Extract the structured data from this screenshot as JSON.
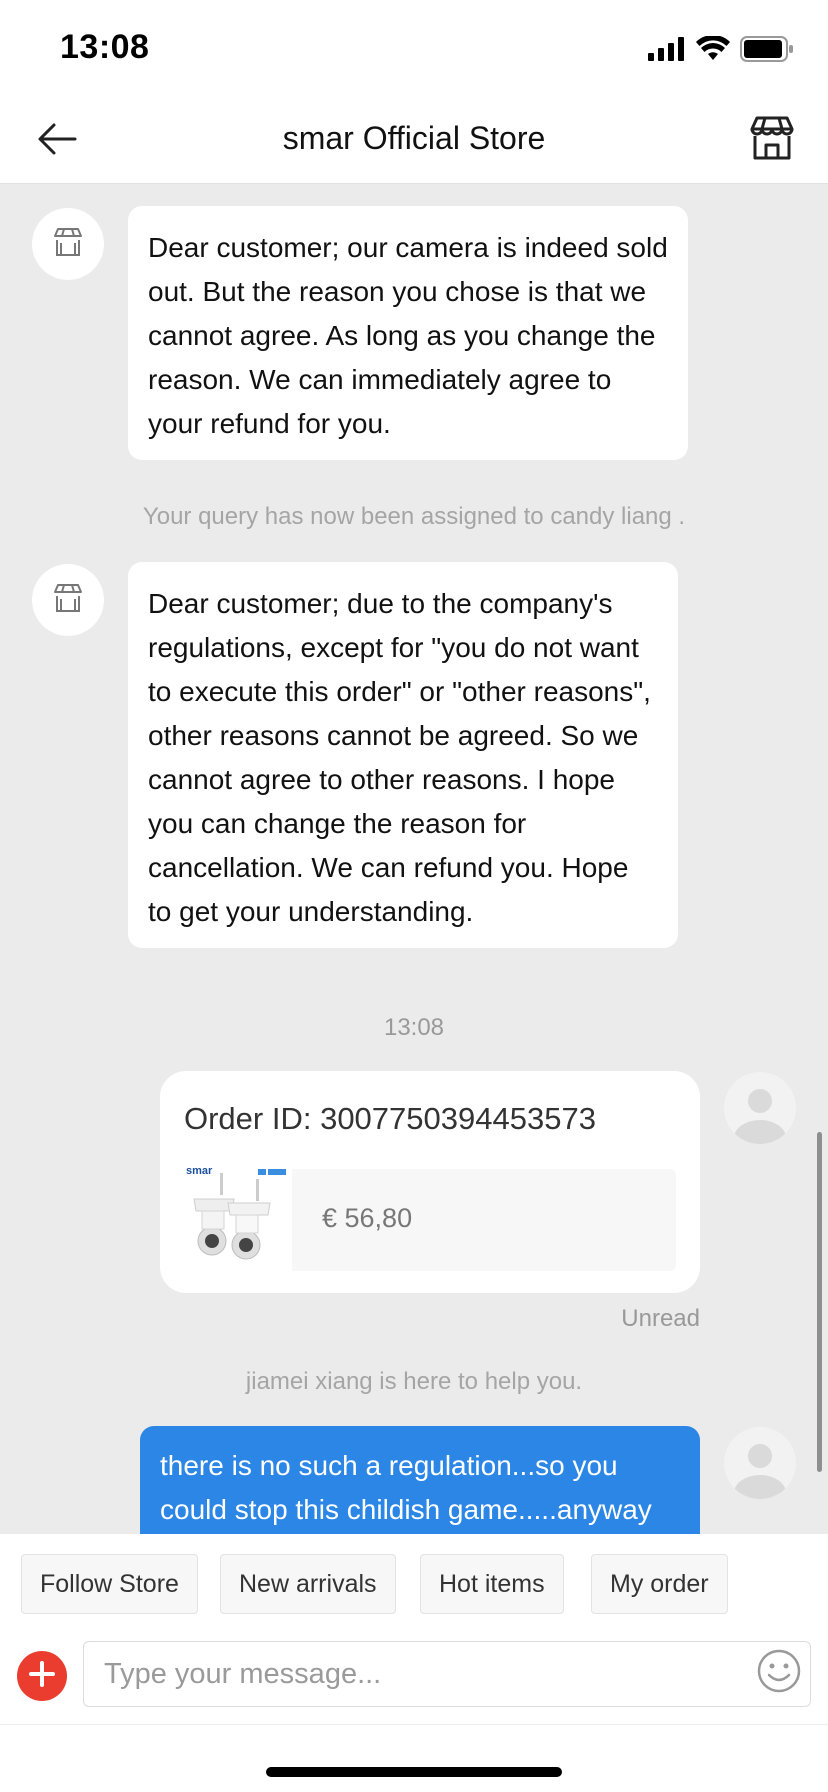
{
  "status_bar": {
    "time": "13:08"
  },
  "nav": {
    "title": "smar Official Store"
  },
  "messages": {
    "store_msg_1": "Dear customer; our camera is indeed sold out. But the reason you chose is that we cannot agree. As long as you change the reason. We can immediately agree to your refund for you.",
    "system_assigned": "Your query has now been assigned to candy liang .",
    "store_msg_2": "Dear customer; due to the company's regulations, except for \"you do not want to execute this order\" or \"other reasons\", other reasons cannot be agreed. So we cannot agree to other reasons. I hope you can change the reason for cancellation. We can refund you. Hope to get your understanding.",
    "timestamp": "13:08",
    "order_card": {
      "order_id_text": "Order ID: 3007750394453573",
      "price": "€ 56,80",
      "product_brand": "smar"
    },
    "read_status": "Unread",
    "system_helper": "jiamei xiang is here to help you.",
    "user_msg": "there is no such a regulation...so you could stop this childish game.....anyway"
  },
  "quick_actions": [
    "Follow Store",
    "New arrivals",
    "Hot items",
    "My order"
  ],
  "input": {
    "placeholder": "Type your message..."
  },
  "colors": {
    "accent_blue": "#2b86e6",
    "add_button_red": "#ea3d2f",
    "chat_background": "#ebebeb"
  }
}
